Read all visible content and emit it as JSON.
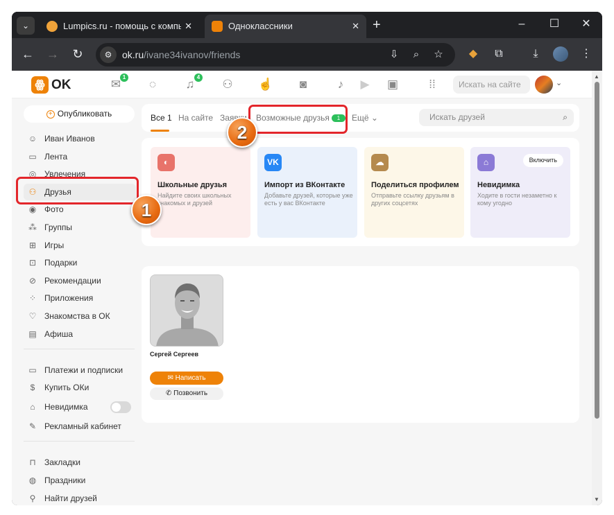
{
  "browser": {
    "tabs": [
      {
        "title": "Lumpics.ru - помощь с компьютером",
        "close": "✕"
      },
      {
        "title": "Одноклассники",
        "close": "✕"
      }
    ],
    "new_tab": "+",
    "url_host": "ok.ru",
    "url_path": "/ivane34ivanov/friends"
  },
  "ok_header": {
    "logo_text": "OK",
    "messages_badge": "1",
    "notifications_badge": "4",
    "search_placeholder": "Искать на сайте"
  },
  "sidebar": {
    "publish": "Опубликовать",
    "items": [
      {
        "label": "Иван Иванов",
        "icon": "person-icon"
      },
      {
        "label": "Лента",
        "icon": "feed-icon"
      },
      {
        "label": "Увлечения",
        "icon": "hobby-icon"
      },
      {
        "label": "Друзья",
        "icon": "friends-icon"
      },
      {
        "label": "Фото",
        "icon": "photo-icon"
      },
      {
        "label": "Группы",
        "icon": "groups-icon"
      },
      {
        "label": "Игры",
        "icon": "gamepad-icon"
      },
      {
        "label": "Подарки",
        "icon": "gift-icon"
      },
      {
        "label": "Рекомендации",
        "icon": "compass-icon"
      },
      {
        "label": "Приложения",
        "icon": "apps-icon"
      },
      {
        "label": "Знакомства в ОК",
        "icon": "dating-icon"
      },
      {
        "label": "Афиша",
        "icon": "ticket-icon"
      }
    ],
    "items2": [
      {
        "label": "Платежи и подписки",
        "icon": "card-icon"
      },
      {
        "label": "Купить ОКи",
        "icon": "coin-icon"
      },
      {
        "label": "Невидимка",
        "icon": "invisible-icon"
      },
      {
        "label": "Рекламный кабинет",
        "icon": "ads-icon"
      }
    ],
    "items3": [
      {
        "label": "Закладки",
        "icon": "bookmark-icon"
      },
      {
        "label": "Праздники",
        "icon": "holiday-icon"
      },
      {
        "label": "Найти друзей",
        "icon": "add-friend-icon"
      }
    ]
  },
  "friend_tabs": {
    "all": "Все 1",
    "online": "На сайте",
    "requests": "Заявки",
    "possible": "Возможные друзья",
    "possible_badge": "1",
    "more": "Ещё",
    "search_placeholder": "Искать друзей"
  },
  "promo_cards": [
    {
      "title": "Школьные друзья",
      "desc": "Найдите своих школьных знакомых и друзей",
      "icon": "school-icon",
      "color": "#e8736a",
      "bg": "#fdeeed"
    },
    {
      "title": "Импорт из ВКонтакте",
      "desc": "Добавьте друзей, которые уже есть у вас ВКонтакте",
      "icon": "vk-icon",
      "icon_text": "VK",
      "color": "#2787f5",
      "bg": "#eaf1fb"
    },
    {
      "title": "Поделиться профилем",
      "desc": "Отправьте ссылку друзьям в других соцсетях",
      "icon": "share-icon",
      "color": "#b58a4e",
      "bg": "#fdf7e8"
    },
    {
      "title": "Невидимка",
      "desc": "Ходите в гости незаметно к кому угодно",
      "icon": "invisible-icon",
      "color": "#8b7ad6",
      "bg": "#efedf9",
      "button": "Включить"
    }
  ],
  "friend": {
    "name": "Сергей Сергеев",
    "write": "Написать",
    "call": "Позвонить"
  },
  "annotations": {
    "marker1": "1",
    "marker2": "2",
    "color": "#e3262b"
  }
}
